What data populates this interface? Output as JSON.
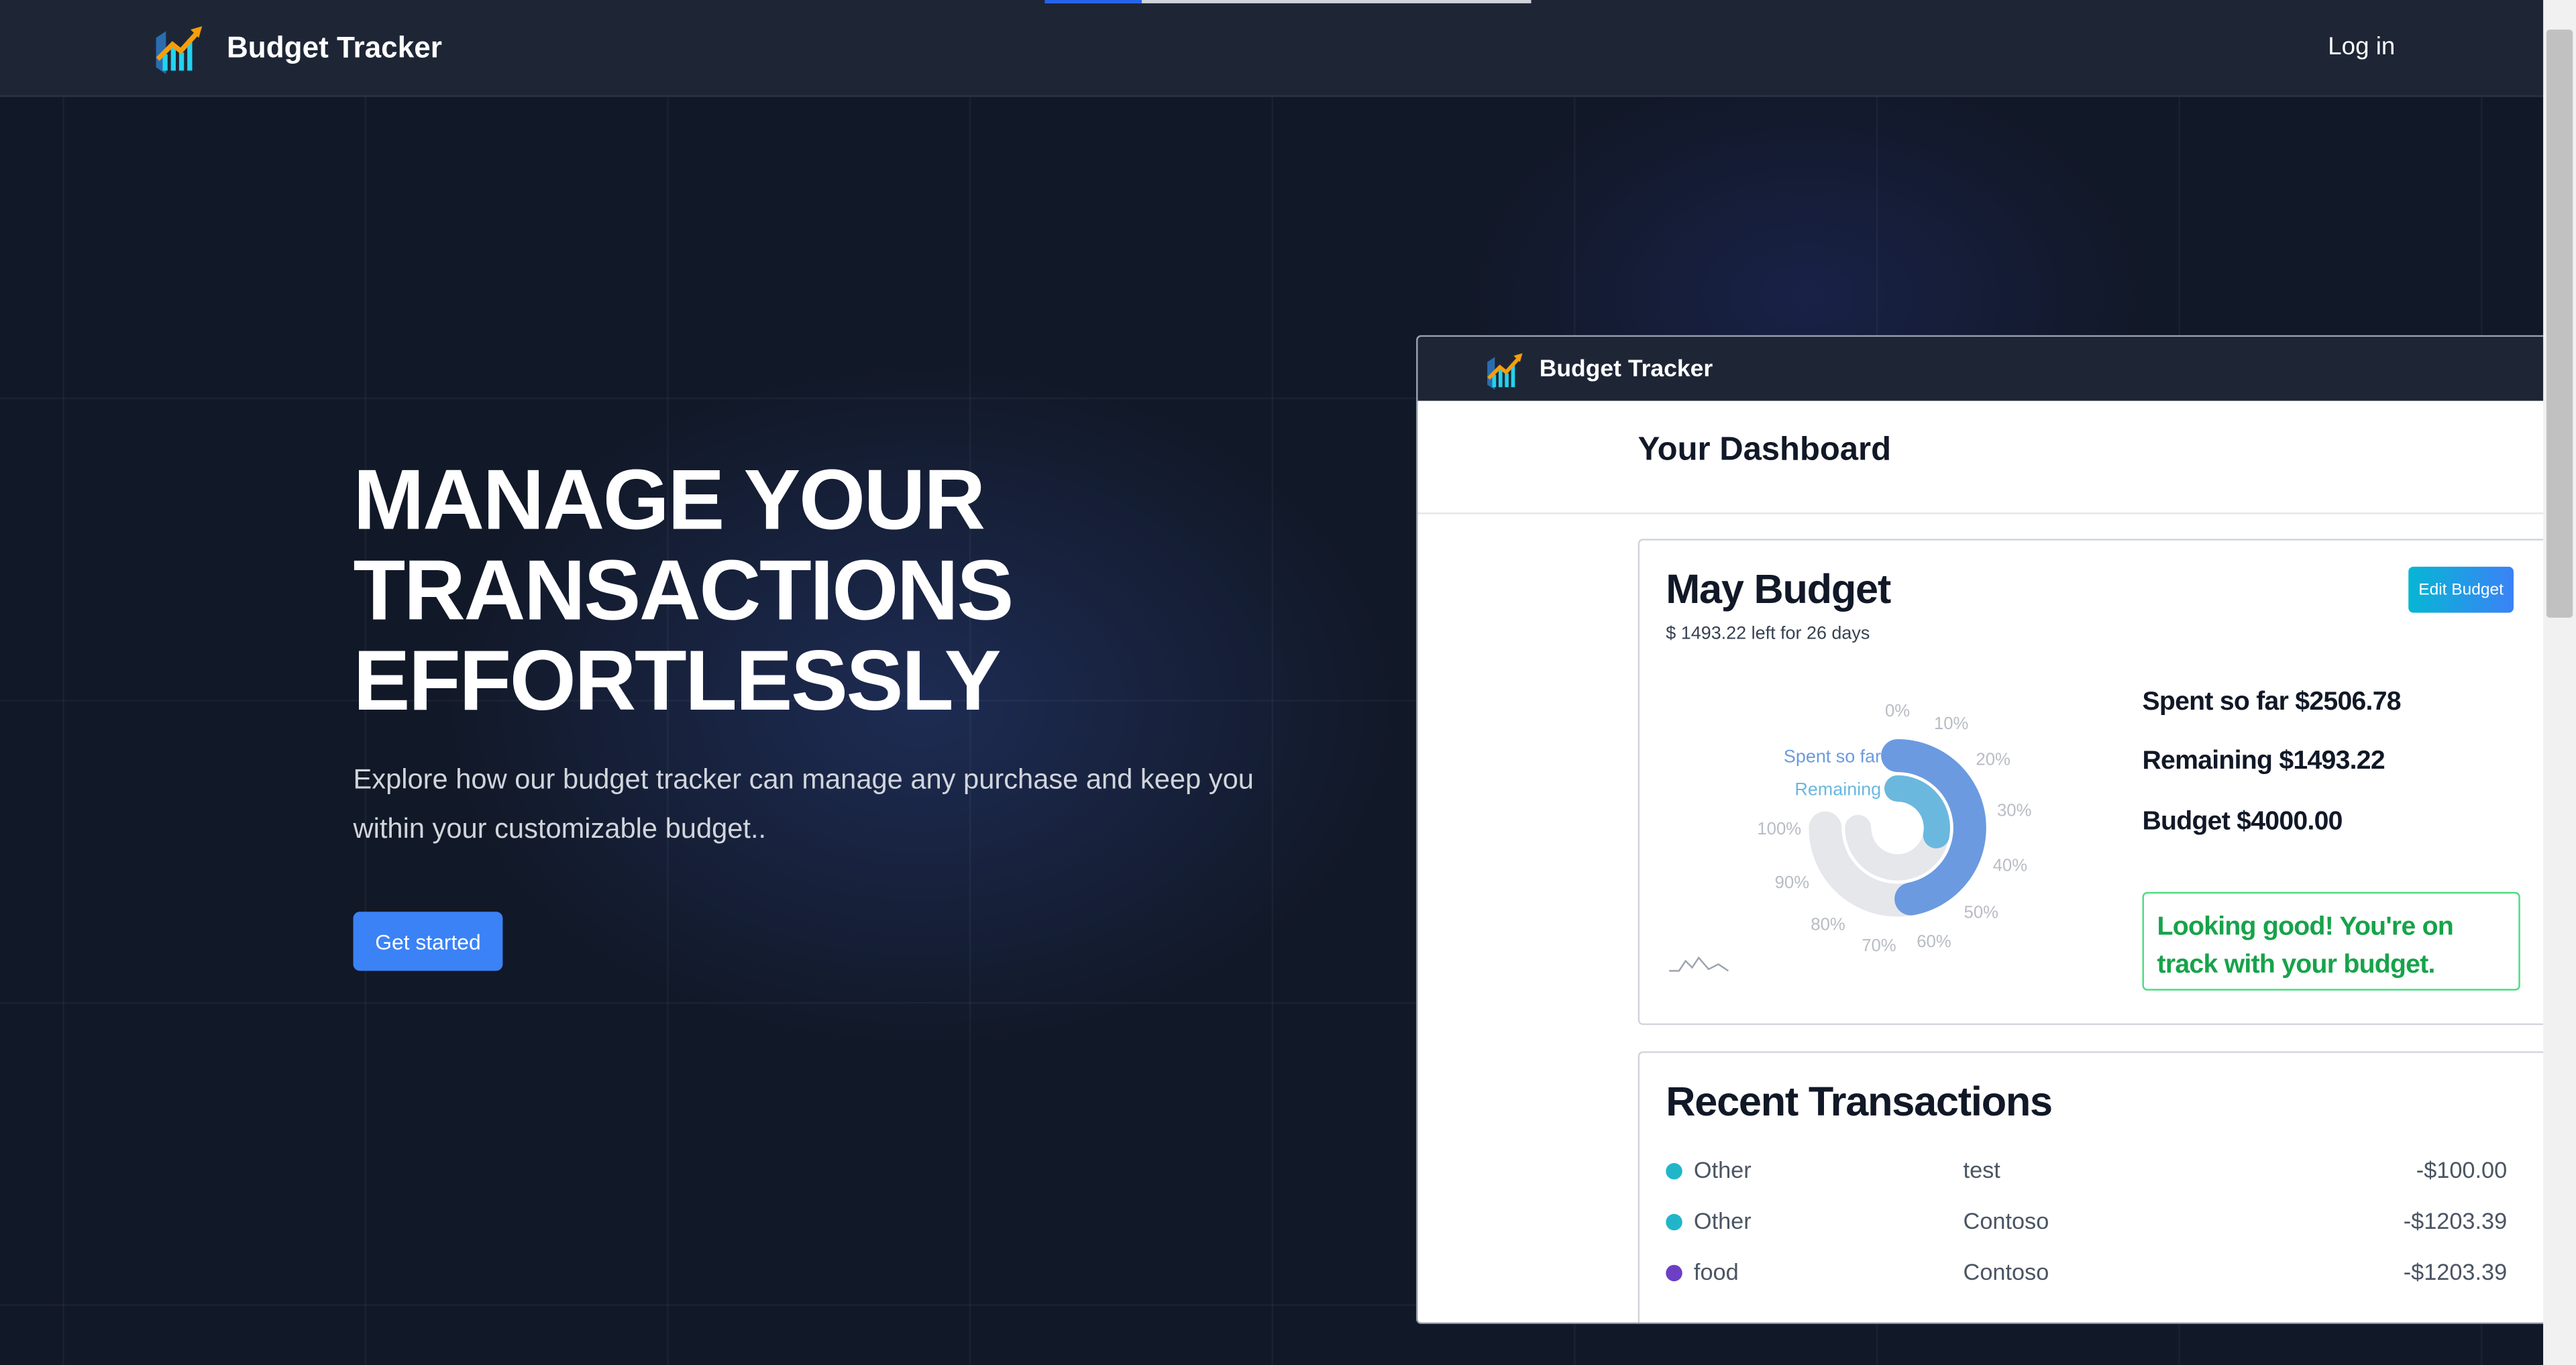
{
  "nav": {
    "brand": "Budget Tracker",
    "login": "Log in",
    "loading_progress": 0.2
  },
  "hero": {
    "title_lines": [
      "MANAGE YOUR",
      "TRANSACTIONS",
      "EFFORTLESSLY"
    ],
    "subtitle": "Explore how our budget tracker can manage any purchase and keep you within your customizable budget..",
    "cta": "Get started"
  },
  "preview": {
    "brand": "Budget Tracker",
    "dashboard_title": "Your Dashboard",
    "budget_card": {
      "title": "May Budget",
      "subtitle": "$ 1493.22 left for 26 days",
      "edit_button": "Edit Budget",
      "spent": "Spent so far $2506.78",
      "remaining": "Remaining $1493.22",
      "budget": "Budget $4000.00",
      "status_message": "Looking good! You're on track with your budget."
    },
    "chart_data": {
      "type": "pie",
      "subtype": "radial-bar",
      "series": [
        {
          "name": "Spent so far",
          "value": 2506.78,
          "percent": 62.7,
          "color": "#6b9ae0"
        },
        {
          "name": "Remaining",
          "value": 1493.22,
          "percent": 37.3,
          "color": "#6ab8de"
        }
      ],
      "track_color": "#e5e7eb",
      "tick_labels": [
        "0%",
        "10%",
        "20%",
        "30%",
        "40%",
        "50%",
        "60%",
        "70%",
        "80%",
        "90%",
        "100%"
      ]
    },
    "transactions": {
      "title": "Recent Transactions",
      "rows": [
        {
          "category": "Other",
          "description": "test",
          "amount": "-$100.00",
          "color": "#22b5c9"
        },
        {
          "category": "Other",
          "description": "Contoso",
          "amount": "-$1203.39",
          "color": "#22b5c9"
        },
        {
          "category": "food",
          "description": "Contoso",
          "amount": "-$1203.39",
          "color": "#6d3fc4"
        }
      ]
    }
  },
  "colors": {
    "background": "#111827",
    "accent": "#3b82f6",
    "success": "#16a34a"
  }
}
